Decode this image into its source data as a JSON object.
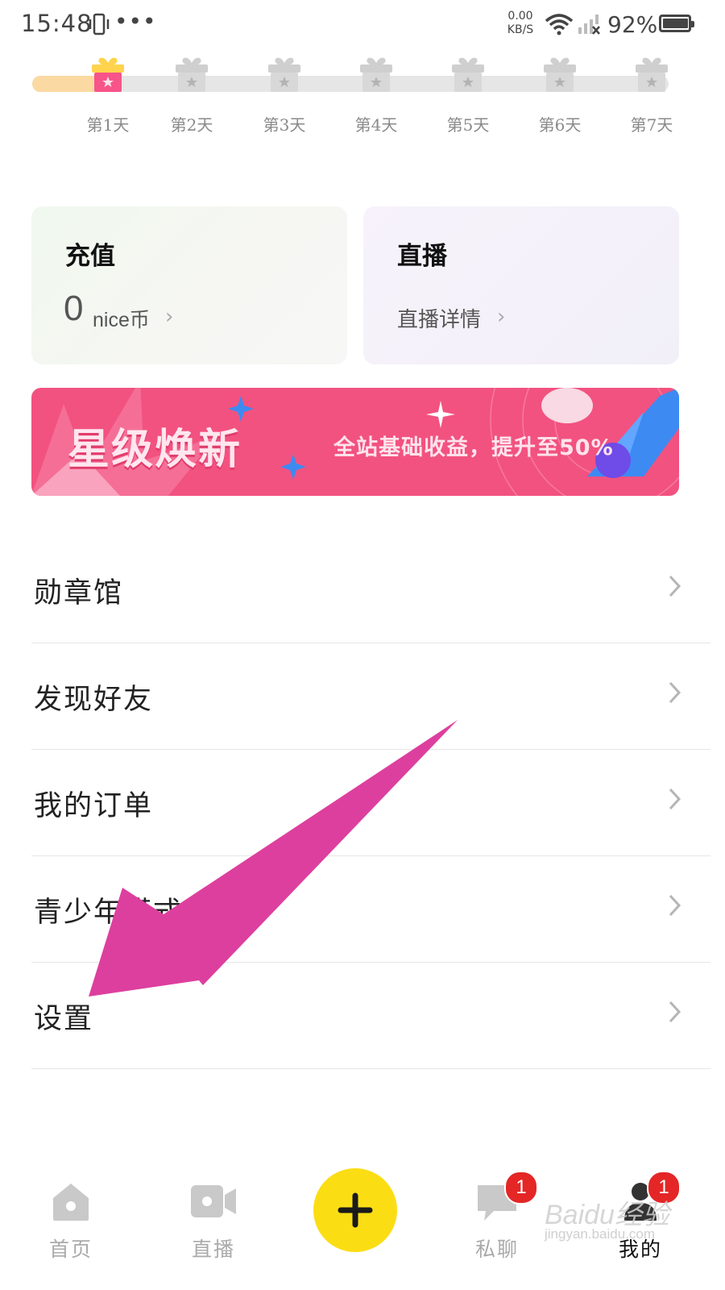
{
  "status_bar": {
    "time": "15:48",
    "dots": "•••",
    "net_speed_value": "0.00",
    "net_speed_unit": "KB/S",
    "battery": "92%",
    "icons": [
      "vibrate-icon",
      "more-icon",
      "wifi-icon",
      "signal-icon",
      "battery-icon"
    ]
  },
  "checkin": {
    "progress_days_done": 1,
    "total_days": 7,
    "days": [
      "第1天",
      "第2天",
      "第3天",
      "第4天",
      "第5天",
      "第6天",
      "第7天"
    ],
    "colors": {
      "active_gift": "#f7548a",
      "inactive_gift": "#d8d8d8",
      "progress_fill": "#fbd9a2"
    }
  },
  "cards": {
    "recharge": {
      "title": "充值",
      "value": "0",
      "unit": "nice币"
    },
    "live": {
      "title": "直播",
      "link": "直播详情"
    }
  },
  "banner": {
    "title": "星级焕新",
    "subtitle": "全站基础收益，提升至50%",
    "bg_color": "#f25280"
  },
  "menu": [
    {
      "label": "勋章馆"
    },
    {
      "label": "发现好友"
    },
    {
      "label": "我的订单"
    },
    {
      "label": "青少年模式"
    },
    {
      "label": "设置"
    }
  ],
  "annotation": {
    "arrow_color": "#dd3f9e",
    "points_to": "设置"
  },
  "bottom_nav": {
    "home": "首页",
    "live": "直播",
    "add_icon": "plus-icon",
    "messages": "私聊",
    "messages_badge": "1",
    "mine": "我的",
    "mine_badge": "1",
    "accent": "#fbdd14"
  },
  "watermark": {
    "text": "Baidu经验",
    "sub": "jingyan.baidu.com"
  }
}
